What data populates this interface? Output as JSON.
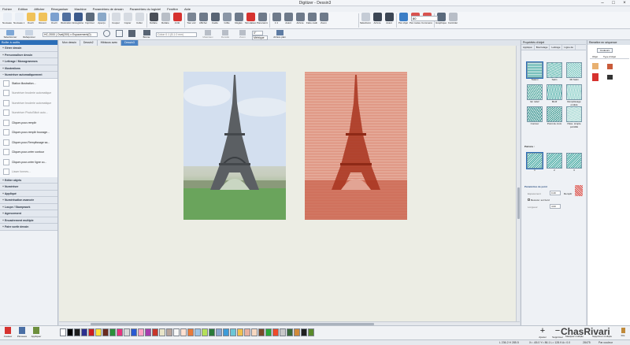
{
  "window": {
    "title": "Digitizer - Dessin3"
  },
  "menu": [
    "Fichier",
    "Edition",
    "Afficher",
    "Réorganiser",
    "Machine",
    "Paramètres de dessin",
    "Paramètres du logiciel",
    "Fenêtre",
    "Aide"
  ],
  "ribbon": [
    {
      "label": "Nouveau",
      "icon": "new-file-icon",
      "color": "#e9eef5"
    },
    {
      "label": "Nouveau à partir",
      "icon": "new-from-icon",
      "color": "#e9eef5"
    },
    {
      "label": "Ouvrir",
      "icon": "open-folder-icon",
      "color": "#f0c25a"
    },
    {
      "label": "Récent",
      "icon": "recent-icon",
      "color": "#f0c25a"
    },
    {
      "label": "Ouvrir",
      "icon": "open-design-icon",
      "color": "#7ba0cf"
    },
    {
      "label": "Illustration",
      "icon": "illustration-icon",
      "color": "#4f6f9f"
    },
    {
      "label": "Enregistrer",
      "icon": "save-icon",
      "color": "#3b5a8c"
    },
    {
      "label": "Imprimer",
      "icon": "print-icon",
      "color": "#5c6b7c"
    },
    {
      "label": "Aperçu",
      "icon": "preview-icon",
      "color": "#8aa8c8"
    },
    {
      "label": "Couper",
      "icon": "cut-icon",
      "color": "#d6dbe2"
    },
    {
      "label": "Copier",
      "icon": "copy-icon",
      "color": "#d6dbe2"
    },
    {
      "label": "Coller",
      "icon": "paste-icon",
      "color": "#d6dbe2"
    },
    {
      "label": "Défaire",
      "icon": "undo-icon",
      "color": "#4a4f58"
    },
    {
      "label": "Refaire",
      "icon": "redo-icon",
      "color": "#b8bec7"
    },
    {
      "label": "Arrêt",
      "icon": "stop-icon",
      "color": "#d6322f"
    },
    {
      "label": "Tout voir",
      "icon": "eye-icon",
      "color": "#7a8594"
    },
    {
      "label": "Afficher",
      "icon": "display-icon",
      "color": "#6e7a8a"
    },
    {
      "label": "Cadre",
      "icon": "frame-icon",
      "color": "#586474"
    },
    {
      "label": "Grille",
      "icon": "grid-icon",
      "color": "#8a96a6"
    },
    {
      "label": "Règles",
      "icon": "rulers-icon",
      "color": "#6d7a8b"
    },
    {
      "label": "Simulateur",
      "icon": "simulator-icon",
      "color": "#d6322f"
    },
    {
      "label": "Panoramique",
      "icon": "pan-icon",
      "color": "#6e7a8a"
    },
    {
      "label": "1:1",
      "icon": "zoom-actual-icon",
      "color": "#6e7a8a"
    },
    {
      "label": "Avant",
      "icon": "zoom-in-icon",
      "color": "#6e7a8a"
    },
    {
      "label": "Arrière",
      "icon": "zoom-out-icon",
      "color": "#6e7a8a"
    },
    {
      "label": "Faire cadrer",
      "icon": "fit-icon",
      "color": "#6e7a8a"
    },
    {
      "label": "Zoom",
      "icon": "zoom-icon",
      "color": "#6e7a8a"
    },
    {
      "label": "Sélectionner",
      "icon": "select-color-icon",
      "color": "#c5ccd6"
    },
    {
      "label": "Arrière",
      "icon": "back-arrow-icon",
      "color": "#3c4654"
    },
    {
      "label": "Avant",
      "icon": "forward-arrow-icon",
      "color": "#3c4654"
    },
    {
      "label": "Par objet",
      "icon": "by-object-icon",
      "color": "#3c7ec6"
    },
    {
      "label": "Par couleur",
      "icon": "by-color-icon",
      "color": "#d9534f"
    },
    {
      "label": "Commencement/Fin",
      "icon": "start-end-icon",
      "color": "#d9534f"
    },
    {
      "label": "Graphiques",
      "icon": "graphics-icon",
      "color": "#5a6a7c"
    },
    {
      "label": "Contrôler",
      "icon": "control-icon",
      "color": "#b8bec7"
    }
  ],
  "zoom_value": "80",
  "ribbon2": {
    "select_label": "Sélectionner",
    "reshape_label": "Refaçonner",
    "machine_value": "HC-2000 | Oval(200) x Espacement(0)",
    "fabric_value": "Coton 0.1 (8-1.0 mm)",
    "hoop_label": "Bonne",
    "material_label": "Matériaux",
    "density_label": "Densité",
    "zoom_label": "Zoom",
    "angle_value": "0°",
    "units_value": "Métrique",
    "shadow_label": "Arrière plan"
  },
  "left_panel": {
    "header": "Boîte à outils",
    "sections_top": [
      {
        "label": "Gérer dessin",
        "open": false
      },
      {
        "label": "Personnaliser dessin",
        "open": false
      },
      {
        "label": "Lettrage / Monogrammes",
        "open": false
      },
      {
        "label": "Illustrations",
        "open": false
      },
      {
        "label": "Numériser automatiquement",
        "open": true
      }
    ],
    "tools": [
      {
        "label": "Station illustration...",
        "disabled": false
      },
      {
        "label": "Numériser broderie automatique",
        "disabled": true
      },
      {
        "label": "Numériser broderie automatique",
        "disabled": true
      },
      {
        "label": "Numériser PhotoStitch auto...",
        "disabled": true
      },
      {
        "label": "Cliquer-pour-remplir",
        "disabled": false
      },
      {
        "label": "Cliquer-pour-remplir bourage...",
        "disabled": false
      },
      {
        "label": "Cliquer-pour-Remplissage sa...",
        "disabled": false
      },
      {
        "label": "Cliquer-pour-créer contour",
        "disabled": false
      },
      {
        "label": "Cliquer-pour-créer ligne co...",
        "disabled": false
      },
      {
        "label": "Lisser formes...",
        "disabled": true
      }
    ],
    "sections_bottom": [
      {
        "label": "Editer objets"
      },
      {
        "label": "Numériser"
      },
      {
        "label": "Appliqué"
      },
      {
        "label": "Numérisation avancée"
      },
      {
        "label": "Loupe / Stumpwork"
      },
      {
        "label": "Agencement"
      },
      {
        "label": "Encadrement multiple"
      },
      {
        "label": "Faire sortir dessin"
      }
    ]
  },
  "tabs": [
    {
      "label": "Mon dessin",
      "active": false
    },
    {
      "label": "Dessin2",
      "active": false
    },
    {
      "label": "Hibiscus avec",
      "active": false
    },
    {
      "label": "Dessin3",
      "active": true
    }
  ],
  "properties": {
    "header": "Propriétés d'objet",
    "tabs": [
      "Appliqué",
      "Bourrelage",
      "Lettrage",
      "Ligne de"
    ],
    "stitch_types": [
      {
        "label": "Tatami",
        "color": "#3fa6a0",
        "selected": true
      },
      {
        "label": "Satin",
        "color": "#5fb8b0",
        "selected": false
      },
      {
        "label": "3D Satin",
        "color": "#78c6c0",
        "selected": false
      },
      {
        "label": "En relief",
        "color": "#4aa39a",
        "selected": false
      },
      {
        "label": "Motif",
        "color": "#4fb0aa",
        "selected": false
      },
      {
        "label": "Remplissage ondulé",
        "color": "#8acfc8",
        "selected": false
      },
      {
        "label": "Contour",
        "color": "#2f8d8a",
        "selected": false
      },
      {
        "label": "Point de croix",
        "color": "#3a968f",
        "selected": false
      },
      {
        "label": "Pass. simple pointillé",
        "color": "#a8dad4",
        "selected": false
      }
    ],
    "patterns_label": "Patrons :",
    "patterns": [
      "1",
      "2",
      "3"
    ],
    "stitch_params_label": "Paramètres de point",
    "spacing_label": "Espacement",
    "spacing_value": "0.40",
    "fill_label": "Remplir",
    "auto_spacing_label": "Recouvr. sur bord",
    "length_label": "Longueur",
    "length_value": "4.00"
  },
  "sequence": {
    "header": "Remettre en séquence",
    "colors_button": "Couleurs",
    "cols": [
      "Objet",
      "Type d'objet"
    ]
  },
  "bottom": {
    "tools": [
      {
        "label": "Couleur",
        "color": "#d6322f"
      },
      {
        "label": "Pinceaux",
        "color": "#4a6fa5"
      },
      {
        "label": "Appliquer",
        "color": "#6d8f3d"
      }
    ],
    "palette": [
      "#ffffff",
      "#000000",
      "#1d1d1d",
      "#2b2f8f",
      "#cc1f1f",
      "#ffe33b",
      "#6b2b1f",
      "#2c8f3a",
      "#e6357e",
      "#d8d8d8",
      "#2a5ad2",
      "#ffa3c5",
      "#a63dad",
      "#c7362a",
      "#e8e4c8",
      "#b7a39a",
      "#f7f7f7",
      "#ffe0d0",
      "#e87a3a",
      "#9ec4e4",
      "#b5e05a",
      "#2a7a3a",
      "#8aa5d0",
      "#3d9bd8",
      "#6cc6d6",
      "#f0c050",
      "#e8b0a0",
      "#f8d8c0",
      "#7a4a2a",
      "#2ca83a",
      "#ee4a2a",
      "#c8c8c8",
      "#3a6a3a",
      "#d08a3a",
      "#1f1f1f",
      "#5a8a2a"
    ],
    "add_label": "Ajouter",
    "remove_label": "Supprimer",
    "mask_label": "Masquer multiple",
    "delete_multi_label": "Supprimer multiple",
    "extra_label": "Fils"
  },
  "status": {
    "size": "L 236.2 H 285.5",
    "position": "X= -65.0 Y= 86.1 L= 128.9 A= 0.0",
    "stitches": "28475",
    "mode": "Par couleur"
  },
  "watermark": "ChasRivari"
}
